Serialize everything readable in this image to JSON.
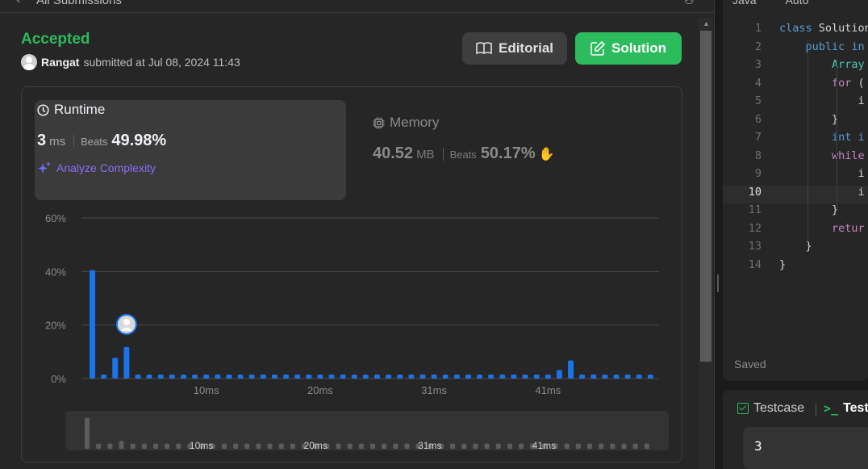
{
  "header": {
    "title": "All Submissions"
  },
  "submission": {
    "status": "Accepted",
    "user": "Rangat",
    "submitted_text": "submitted at Jul 08, 2024 11:43"
  },
  "buttons": {
    "editorial": "Editorial",
    "solution": "Solution"
  },
  "runtime": {
    "title": "Runtime",
    "value": "3",
    "unit": "ms",
    "beats_label": "Beats",
    "beats": "49.98%",
    "analyze": "Analyze Complexity"
  },
  "memory": {
    "title": "Memory",
    "value": "40.52",
    "unit": "MB",
    "beats_label": "Beats",
    "beats": "50.17%"
  },
  "colors": {
    "accent_green": "#2cbb5d",
    "bar_blue": "#1a73e8",
    "purple": "#8d6cf5"
  },
  "chart_data": {
    "type": "bar",
    "ylabel": "",
    "xlabel": "",
    "y_ticks": [
      "60%",
      "40%",
      "20%",
      "0%"
    ],
    "ylim": [
      0,
      60
    ],
    "x_tick_labels": [
      {
        "label": "10ms",
        "bar_index": 10
      },
      {
        "label": "20ms",
        "bar_index": 20
      },
      {
        "label": "31ms",
        "bar_index": 30
      },
      {
        "label": "41ms",
        "bar_index": 40
      }
    ],
    "values": [
      40.5,
      1.5,
      7.8,
      11.8,
      1.5,
      1.5,
      1.5,
      1.5,
      1.5,
      1.5,
      1.5,
      1.5,
      1.5,
      1.5,
      1.5,
      1.5,
      1.5,
      1.5,
      1.5,
      1.5,
      1.5,
      1.5,
      1.5,
      1.5,
      1.5,
      1.5,
      1.5,
      1.5,
      1.5,
      1.5,
      1.5,
      1.5,
      1.5,
      1.5,
      1.5,
      1.5,
      1.5,
      1.5,
      1.5,
      1.5,
      1.5,
      3.2,
      6.8,
      1.5,
      1.5,
      1.5,
      1.5,
      1.5,
      1.5,
      1.5
    ],
    "user_bar_index": 3,
    "overview_values": [
      12,
      2,
      2,
      3,
      2,
      2,
      2,
      2,
      2,
      2,
      2,
      2,
      2,
      2,
      2,
      2,
      2,
      2,
      2,
      2,
      2,
      2,
      2,
      2,
      2,
      2,
      2,
      2,
      2,
      2,
      2,
      2,
      2,
      2,
      2,
      2,
      2,
      2,
      2,
      2,
      2,
      2,
      2,
      2,
      2,
      2,
      2,
      2,
      2,
      2
    ],
    "overview_tick_labels": [
      {
        "label": "10ms",
        "bar_index": 10
      },
      {
        "label": "20ms",
        "bar_index": 20
      },
      {
        "label": "31ms",
        "bar_index": 30
      },
      {
        "label": "41ms",
        "bar_index": 40
      }
    ]
  },
  "editor": {
    "language": "Java",
    "mode": "Auto",
    "lines": [
      {
        "n": "1",
        "text": "class Solution"
      },
      {
        "n": "2",
        "text": "    public in"
      },
      {
        "n": "3",
        "text": "        Array"
      },
      {
        "n": "4",
        "text": "        for ("
      },
      {
        "n": "5",
        "text": "            i"
      },
      {
        "n": "6",
        "text": "        }"
      },
      {
        "n": "7",
        "text": "        int i"
      },
      {
        "n": "8",
        "text": "        while"
      },
      {
        "n": "9",
        "text": "            i"
      },
      {
        "n": "10",
        "text": "            i"
      },
      {
        "n": "11",
        "text": "        }"
      },
      {
        "n": "12",
        "text": "        retur"
      },
      {
        "n": "13",
        "text": "    }"
      },
      {
        "n": "14",
        "text": "}"
      }
    ],
    "saved": "Saved"
  },
  "testcase": {
    "tab": "Testcase",
    "result_tab": "Test",
    "prompt": ">_",
    "value": "3"
  }
}
